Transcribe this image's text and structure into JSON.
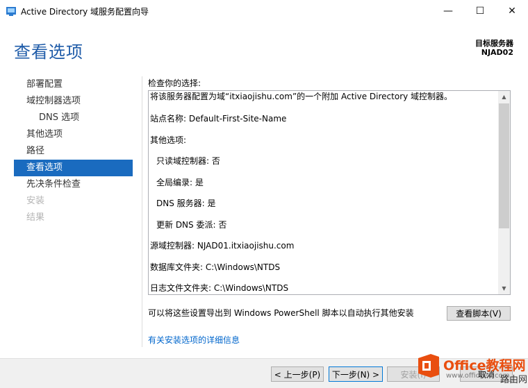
{
  "window": {
    "title": "Active Directory 域服务配置向导",
    "minimize": "—",
    "maximize": "☐",
    "close": "✕"
  },
  "header": {
    "page_title": "查看选项",
    "target_label": "目标服务器",
    "target_name": "NJAD02"
  },
  "nav": {
    "items": [
      {
        "label": "部署配置",
        "state": "normal"
      },
      {
        "label": "域控制器选项",
        "state": "normal"
      },
      {
        "label": "DNS 选项",
        "state": "sub"
      },
      {
        "label": "其他选项",
        "state": "normal"
      },
      {
        "label": "路径",
        "state": "normal"
      },
      {
        "label": "查看选项",
        "state": "active"
      },
      {
        "label": "先决条件检查",
        "state": "normal"
      },
      {
        "label": "安装",
        "state": "disabled"
      },
      {
        "label": "结果",
        "state": "disabled"
      }
    ]
  },
  "main": {
    "review_label": "检查你的选择:",
    "review_lines": [
      "将该服务器配置为域“itxiaojishu.com”的一个附加 Active Directory 域控制器。",
      "站点名称: Default-First-Site-Name",
      "其他选项:",
      "只读域控制器: 否",
      "全局编录: 是",
      "DNS 服务器: 是",
      "更新 DNS 委派: 否",
      "源域控制器: NJAD01.itxiaojishu.com",
      "数据库文件夹: C:\\Windows\\NTDS",
      "日志文件文件夹: C:\\Windows\\NTDS"
    ],
    "export_text": "可以将这些设置导出到 Windows PowerShell 脚本以自动执行其他安装",
    "view_script_button": "查看脚本(V)",
    "more_info_link": "有关安装选项的详细信息"
  },
  "footer": {
    "prev_button": "< 上一步(P)",
    "next_button": "下一步(N) >",
    "install_button": "安装(I)",
    "cancel_button": "取消"
  },
  "watermark": {
    "brand": "Office教程网",
    "url": "www.office26.com",
    "extra": "路由网"
  },
  "colors": {
    "accent": "#1a6bbf",
    "title_blue": "#1e5ba8",
    "link": "#0066cc",
    "watermark_orange": "#e94e0f"
  }
}
